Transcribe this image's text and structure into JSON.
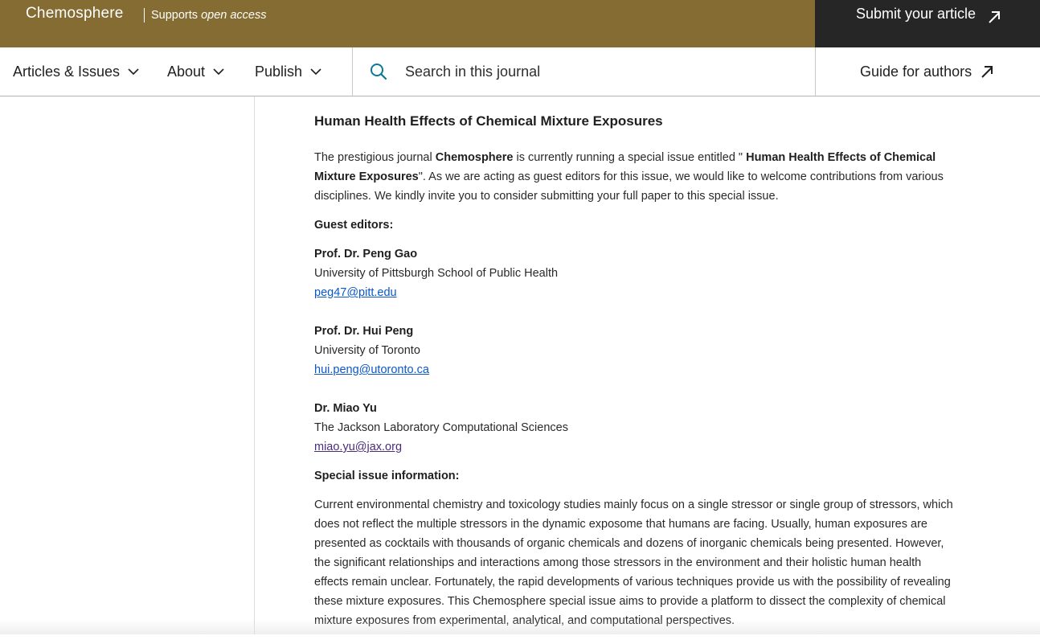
{
  "header": {
    "journal_name": "Chemosphere",
    "open_access_prefix": "Supports",
    "open_access_emphasis": "open access",
    "submit_label": "Submit your article",
    "brand_color": "#846c32",
    "submit_bg": "#262626"
  },
  "nav": {
    "items": [
      {
        "label": "Articles & Issues"
      },
      {
        "label": "About"
      },
      {
        "label": "Publish"
      }
    ],
    "search_placeholder": "Search in this journal",
    "guide_label": "Guide for authors"
  },
  "article": {
    "title": "Human Health Effects of Chemical Mixture Exposures",
    "intro_a": "The prestigious journal ",
    "intro_journal": "Chemosphere",
    "intro_b": " is currently running a special issue entitled \" ",
    "intro_issue": "Human Health Effects of Chemical Mixture Exposures",
    "intro_c": "\". As we are acting as guest editors for this issue, we would like to welcome contributions from various disciplines. We kindly invite you to consider submitting your full paper to this special issue.",
    "guest_editors_heading": "Guest editors:",
    "editors": [
      {
        "name": "Prof. Dr. Peng Gao",
        "affiliation": "University of Pittsburgh School of Public Health",
        "email": "peg47@pitt.edu"
      },
      {
        "name": "Prof. Dr. Hui Peng",
        "affiliation": "University of Toronto",
        "email": "hui.peng@utoronto.ca"
      },
      {
        "name": "Dr. Miao Yu",
        "affiliation": "The Jackson Laboratory Computational Sciences",
        "email": "miao.yu@jax.org"
      }
    ],
    "special_info_heading": "Special issue information:",
    "special_info_body": "Current environmental chemistry and toxicology studies mainly focus on a single stressor or single group of stressors, which does not reflect the multiple stressors in the dynamic exposome that humans are facing. Usually, human exposures are presented as cocktails with thousands of organic chemicals and dozens of inorganic chemicals being presented. However, the significant relationships and interactions among those stressors in the environment and their holistic human health effects remain unclear. Fortunately, the rapid developments of various techniques provide us with the possibility of revealing these mixture exposures. This Chemosphere special issue aims to provide a platform to dissect the complexity of chemical mixture exposures from experimental, analytical, and computational perspectives."
  },
  "icons": {
    "chevron": "chevron-down-icon",
    "external": "external-link-arrow-icon",
    "search": "search-icon"
  }
}
